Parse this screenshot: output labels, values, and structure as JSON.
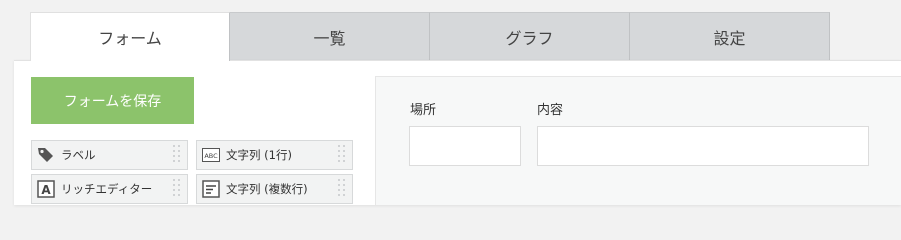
{
  "tabs": [
    {
      "label": "フォーム",
      "active": true
    },
    {
      "label": "一覧",
      "active": false
    },
    {
      "label": "グラフ",
      "active": false
    },
    {
      "label": "設定",
      "active": false
    }
  ],
  "toolbar": {
    "save_label": "フォームを保存"
  },
  "palette": {
    "items": [
      {
        "label": "ラベル",
        "icon": "tag-icon"
      },
      {
        "label": "文字列 (1行)",
        "icon": "abc-text-icon"
      },
      {
        "label": "リッチエディター",
        "icon": "rich-editor-icon"
      },
      {
        "label": "文字列 (複数行)",
        "icon": "multiline-text-icon"
      }
    ]
  },
  "form": {
    "fields": [
      {
        "label": "場所",
        "value": ""
      },
      {
        "label": "内容",
        "value": ""
      }
    ]
  },
  "colors": {
    "accent_green": "#8cc36b",
    "tab_inactive": "#d6d8da",
    "panel_bg": "#ffffff",
    "page_bg": "#f2f2f2"
  }
}
